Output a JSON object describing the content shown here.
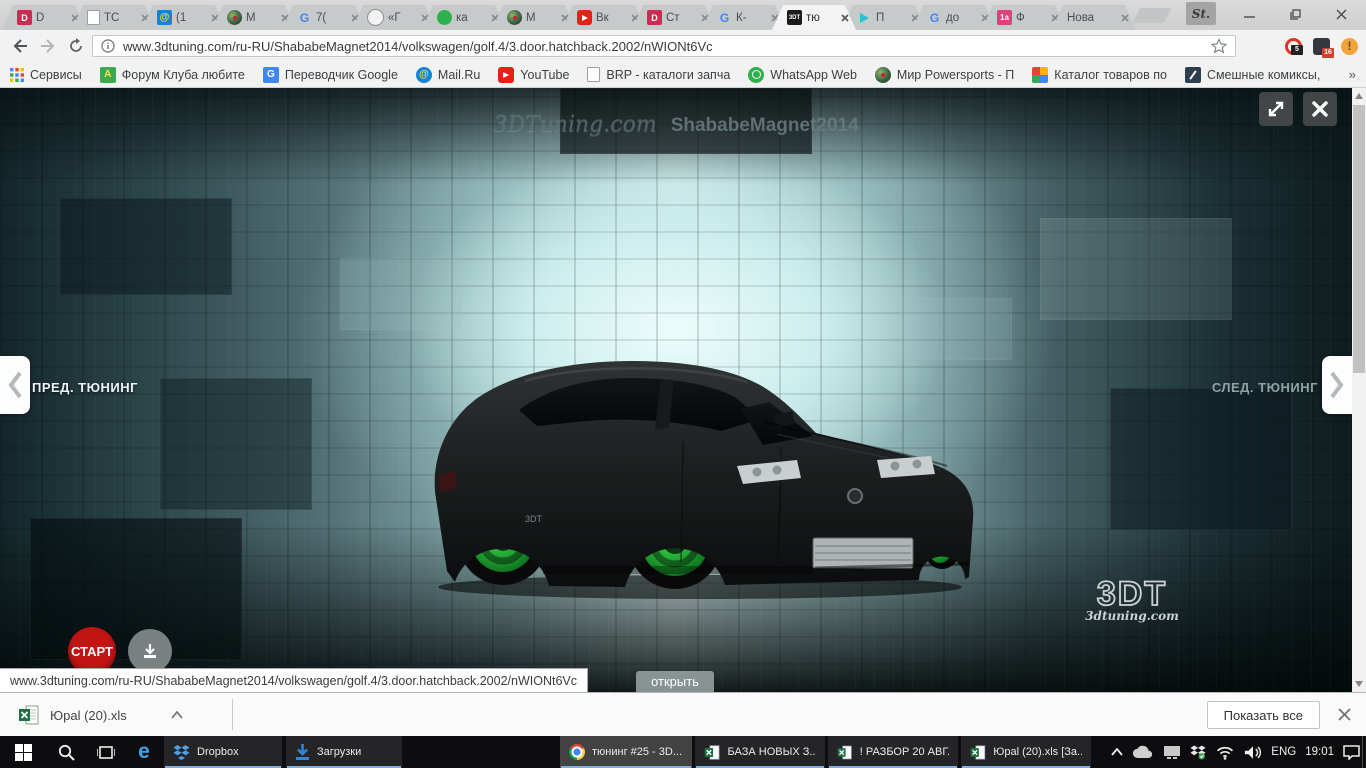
{
  "glyphs": {
    "drive2": "D",
    "google": "G",
    "mailru": "@",
    "one_a": "1а",
    "tdt": "3DT",
    "forum": "A",
    "translate": "G",
    "opera": "O",
    "edge": "e",
    "globe2": "«Г"
  },
  "window_chrome": {
    "st_badge": "St."
  },
  "tabstrip": {
    "tabs": [
      {
        "icon": "drive2-icon",
        "label": "D"
      },
      {
        "icon": "page-icon",
        "label": "ТС"
      },
      {
        "icon": "mailru-icon",
        "label": "(1"
      },
      {
        "icon": "globe-icon",
        "label": "М"
      },
      {
        "icon": "google-icon",
        "label": "7("
      },
      {
        "icon": "globe-sketch-icon",
        "label": "«Г"
      },
      {
        "icon": "green-app-icon",
        "label": "ка"
      },
      {
        "icon": "globe-icon",
        "label": "М"
      },
      {
        "icon": "youtube-icon",
        "label": "Вк"
      },
      {
        "icon": "drive2-icon",
        "label": "Ст"
      },
      {
        "icon": "google-icon",
        "label": "К-"
      },
      {
        "icon": "3dt-icon",
        "label": "тю"
      },
      {
        "icon": "playstore-icon",
        "label": "П"
      },
      {
        "icon": "google-icon",
        "label": "до"
      },
      {
        "icon": "1a-icon",
        "label": "Ф"
      },
      {
        "icon": "none",
        "label": "Нова"
      }
    ]
  },
  "toolbar": {
    "url": "www.3dtuning.com/ru-RU/ShababeMagnet2014/volkswagen/golf.4/3.door.hatchback.2002/nWIONt6Vc",
    "ext_icons": [
      "opera-extension-icon",
      "adblock-extension-icon",
      "chrome-menu-update-icon"
    ],
    "ext1_badge": "5",
    "ext2_badge": "16",
    "menu_badge": "!"
  },
  "bookmarks_bar": {
    "items": [
      {
        "icon": "apps-grid-icon",
        "label": "Сервисы"
      },
      {
        "icon": "forum-icon",
        "label": "Форум Клуба любите"
      },
      {
        "icon": "translate-icon",
        "label": "Переводчик Google"
      },
      {
        "icon": "mailru-icon",
        "label": "Mail.Ru"
      },
      {
        "icon": "youtube-icon",
        "label": "YouTube"
      },
      {
        "icon": "page-icon",
        "label": "BRP - каталоги запча"
      },
      {
        "icon": "whatsapp-icon",
        "label": "WhatsApp Web"
      },
      {
        "icon": "globe-icon",
        "label": "Мир Powersports - П"
      },
      {
        "icon": "catalog-icon",
        "label": "Каталог товаров по"
      },
      {
        "icon": "comics-icon",
        "label": "Смешные комиксы,"
      }
    ],
    "overflow": "»"
  },
  "page": {
    "watermark_brand": "3DTuning.com",
    "watermark_user": "ShababeMagnet2014",
    "prev_label": "ПРЕД. ТЮНИНГ",
    "next_label": "СЛЕД. ТЮНИНГ",
    "start_label": "СТАРТ",
    "open_label": "открыть",
    "logo_text": "3DT",
    "logo_domain": "3dtuning.com",
    "status_url": "www.3dtuning.com/ru-RU/ShababeMagnet2014/volkswagen/golf.4/3.door.hatchback.2002/nWIONt6Vc",
    "colors": {
      "wheel_green": "#25b335",
      "start_red": "#c31414",
      "scene_teal": "#9fc6c7"
    }
  },
  "downloads_bar": {
    "file_name": "Юpal (20).xls",
    "show_all_label": "Показать все"
  },
  "taskbar": {
    "system_icons": [
      "start-icon",
      "search-icon",
      "task-view-icon",
      "edge-icon"
    ],
    "pinned": [
      {
        "icon": "dropbox-icon",
        "label": "Dropbox"
      },
      {
        "icon": "downloads-arrow-icon",
        "label": "Загрузки"
      }
    ],
    "windows": [
      {
        "icon": "chrome-icon",
        "label": "тюнинг #25 - 3D..."
      },
      {
        "icon": "excel-icon",
        "label": "БАЗА НОВЫХ З..."
      },
      {
        "icon": "excel-icon",
        "label": "! РАЗБОР 20 АВГ..."
      },
      {
        "icon": "excel-icon",
        "label": "Юpal (20).xls  [За..."
      }
    ],
    "tray": {
      "icons": [
        "hidden-icons-chevron",
        "onedrive-cloud-icon",
        "display-icon",
        "dropbox-sync-icon",
        "wifi-icon",
        "volume-icon",
        "action-center-icon"
      ],
      "language": "ENG",
      "time": "19:01"
    }
  }
}
